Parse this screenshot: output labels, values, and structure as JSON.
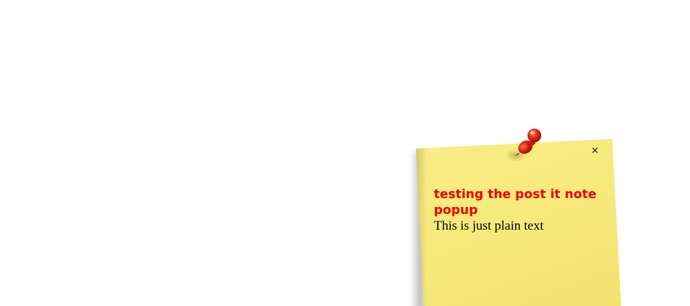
{
  "postit": {
    "title": "testing the post it note popup",
    "body": "This is just plain text",
    "close_label": "×",
    "close_icon": "close-icon",
    "pin_icon": "pushpin-icon",
    "colors": {
      "note": "#f7ea7c",
      "title": "#ee0000",
      "body": "#000000",
      "pin": "#e32414"
    }
  }
}
